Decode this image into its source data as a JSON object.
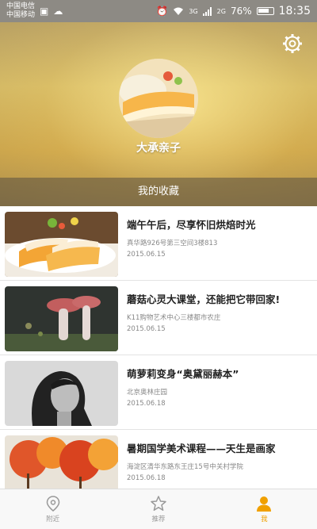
{
  "status_bar": {
    "carrier_1": "中国电信",
    "carrier_2": "中国移动",
    "network_1": "3G",
    "network_2": "2G",
    "battery": "76%",
    "time": "18:35"
  },
  "profile": {
    "username": "大承亲子",
    "favorites_tab": "我的收藏"
  },
  "favorites": [
    {
      "title": "端午午后，尽享怀旧烘焙时光",
      "address": "真华路926号第三空间3楼813",
      "date": "2015.06.15"
    },
    {
      "title": "蘑菇心灵大课堂，还能把它带回家!",
      "address": "K11购物艺术中心三楼都市农庄",
      "date": "2015.06.15"
    },
    {
      "title": "萌萝莉变身“奥黛丽赫本”",
      "address": "北京奥林庄园",
      "date": "2015.06.18"
    },
    {
      "title": "暑期国学美术课程——天生是画家",
      "address": "海淀区清华东路东王庄15号中关村学院",
      "date": "2015.06.18"
    }
  ],
  "bottom_nav": {
    "nearby": "附近",
    "recommend": "推荐",
    "me": "我"
  },
  "colors": {
    "accent": "#f0a000"
  }
}
